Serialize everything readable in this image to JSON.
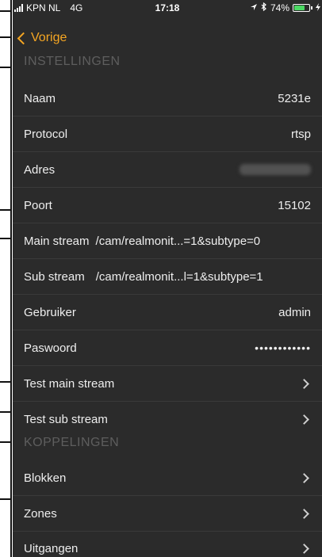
{
  "status_bar": {
    "carrier": "KPN NL",
    "network": "4G",
    "time": "17:18",
    "battery_text": "74%",
    "battery_level": 0.74,
    "battery_color": "#4cd964",
    "icons": [
      "signal-icon",
      "location-arrow-icon",
      "bluetooth-icon",
      "battery-icon",
      "charging-icon"
    ]
  },
  "nav": {
    "back_label": "Vorige",
    "accent_color": "#f5a623"
  },
  "settings": {
    "header": "INSTELLINGEN",
    "rows": [
      {
        "label": "Naam",
        "value": "5231e"
      },
      {
        "label": "Protocol",
        "value": "rtsp"
      },
      {
        "label": "Adres",
        "value": ""
      },
      {
        "label": "Poort",
        "value": "15102"
      },
      {
        "label": "Main stream",
        "value": "/cam/realmonit...=1&subtype=0"
      },
      {
        "label": "Sub stream",
        "value": "/cam/realmonit...l=1&subtype=1"
      },
      {
        "label": "Gebruiker",
        "value": "admin"
      },
      {
        "label": "Paswoord",
        "value": "••••••••••••"
      },
      {
        "label": "Test main stream"
      },
      {
        "label": "Test sub stream"
      }
    ]
  },
  "couplings": {
    "header": "KOPPELINGEN",
    "rows": [
      {
        "label": "Blokken"
      },
      {
        "label": "Zones"
      },
      {
        "label": "Uitgangen"
      }
    ]
  }
}
